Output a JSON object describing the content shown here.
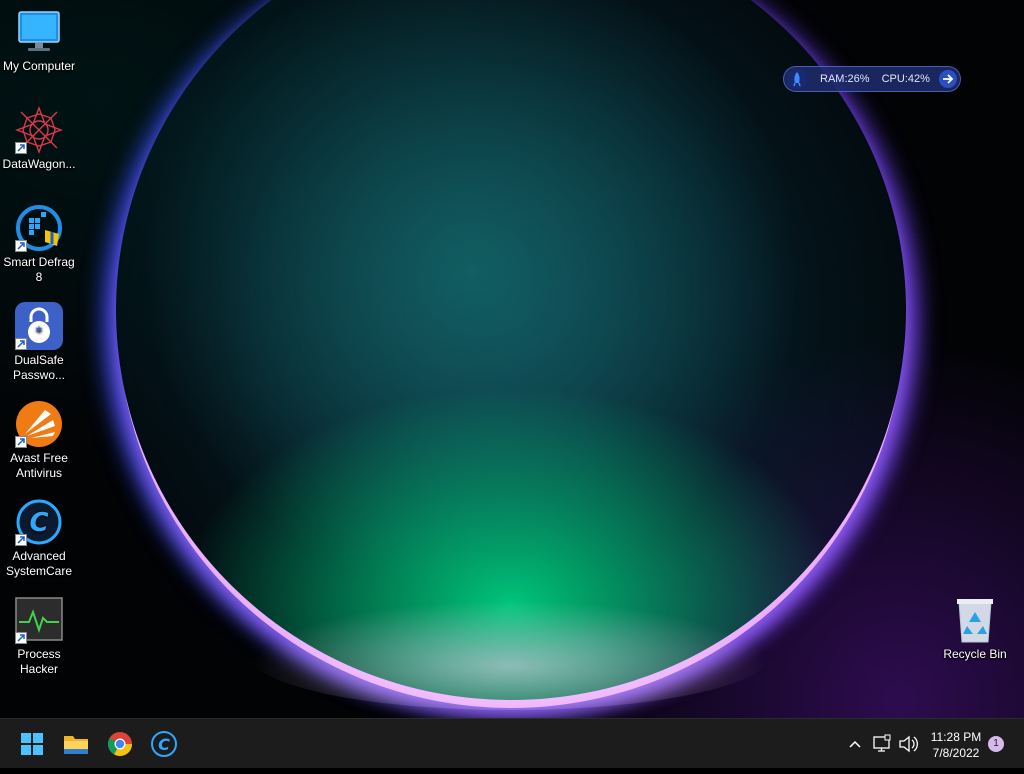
{
  "desktop": {
    "icons": [
      {
        "label": "My Computer",
        "icon": "monitor-icon"
      },
      {
        "label": "DataWagon...",
        "icon": "datawagon-icon"
      },
      {
        "label": "Smart Defrag 8",
        "icon": "smart-defrag-icon"
      },
      {
        "label": "DualSafe Passwo...",
        "icon": "dualsafe-icon"
      },
      {
        "label": "Avast Free Antivirus",
        "icon": "avast-icon"
      },
      {
        "label": "Advanced SystemCare",
        "icon": "advanced-systemcare-icon"
      },
      {
        "label": "Process Hacker",
        "icon": "process-hacker-icon"
      },
      {
        "label": "Recycle Bin",
        "icon": "recycle-bin-icon"
      }
    ]
  },
  "widget": {
    "ram": "RAM:26%",
    "cpu": "CPU:42%"
  },
  "taskbar": {
    "apps": [
      "start-icon",
      "file-explorer-icon",
      "chrome-icon",
      "advanced-systemcare-icon"
    ],
    "clock_time": "11:28 PM",
    "clock_date": "7/8/2022",
    "notification_count": "1"
  },
  "colors": {
    "taskbar_bg": "#1c1c1c",
    "accent_blue": "#2ea8ff"
  }
}
